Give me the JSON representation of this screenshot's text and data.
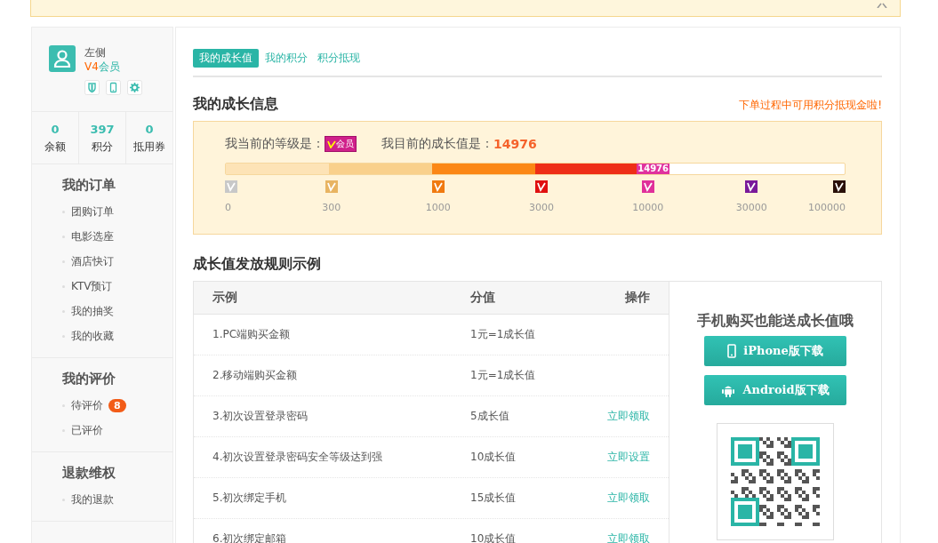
{
  "notice": {
    "dismissible": true
  },
  "profile": {
    "name": "左侧",
    "level": "V4",
    "level_suffix": "会员"
  },
  "stats": [
    {
      "value": "0",
      "label": "余额"
    },
    {
      "value": "397",
      "label": "积分"
    },
    {
      "value": "0",
      "label": "抵用券"
    }
  ],
  "sidebar": {
    "sections": [
      {
        "title": "我的订单",
        "items": [
          {
            "label": "团购订单"
          },
          {
            "label": "电影选座"
          },
          {
            "label": "酒店快订"
          },
          {
            "label": "KTV预订"
          },
          {
            "label": "我的抽奖"
          },
          {
            "label": "我的收藏"
          }
        ]
      },
      {
        "title": "我的评价",
        "items": [
          {
            "label": "待评价",
            "badge": "8"
          },
          {
            "label": "已评价"
          }
        ]
      },
      {
        "title": "退款维权",
        "items": [
          {
            "label": "我的退款"
          }
        ]
      }
    ]
  },
  "tabs": [
    {
      "label": "我的成长值",
      "selected": true
    },
    {
      "label": "我的积分",
      "selected": false
    },
    {
      "label": "积分抵现",
      "selected": false
    }
  ],
  "growth": {
    "title": "我的成长信息",
    "promo": "下单过程中可用积分抵现金啦!",
    "level_label": "我当前的等级是：",
    "level_badge": "会员",
    "value_label": "我目前的成长值是：",
    "value": "14976",
    "bar_label": "14976",
    "level": 0.717,
    "tiers": [
      {
        "label": "0",
        "color": "#c8c8c8"
      },
      {
        "label": "300",
        "color": "#e8b462"
      },
      {
        "label": "1000",
        "color": "#f07a10"
      },
      {
        "label": "3000",
        "color": "#e01010"
      },
      {
        "label": "10000",
        "color": "#e0309a"
      },
      {
        "label": "30000",
        "color": "#7a1a9a"
      },
      {
        "label": "100000",
        "color": "#2a1008"
      }
    ]
  },
  "rules": {
    "title": "成长值发放规则示例",
    "columns": [
      "示例",
      "分值",
      "操作"
    ],
    "rows": [
      {
        "example": "1.PC端购买金额",
        "value": "1元=1成长值"
      },
      {
        "example": "2.移动端购买金额",
        "value": "1元=1成长值"
      },
      {
        "example": "3.初次设置登录密码",
        "value": "5成长值",
        "action": "立即领取"
      },
      {
        "example": "4.初次设置登录密码安全等级达到强",
        "value": "10成长值",
        "action": "立即设置"
      },
      {
        "example": "5.初次绑定手机",
        "value": "15成长值",
        "action": "立即领取"
      },
      {
        "example": "6.初次绑定邮箱",
        "value": "10成长值",
        "action": "立即领取"
      }
    ]
  },
  "app_promo": {
    "title": "手机购买也能送成长值哦",
    "buttons": [
      {
        "kind": "iphone",
        "label": "iPhone版下载"
      },
      {
        "kind": "android",
        "label": "Android版下载"
      }
    ]
  }
}
